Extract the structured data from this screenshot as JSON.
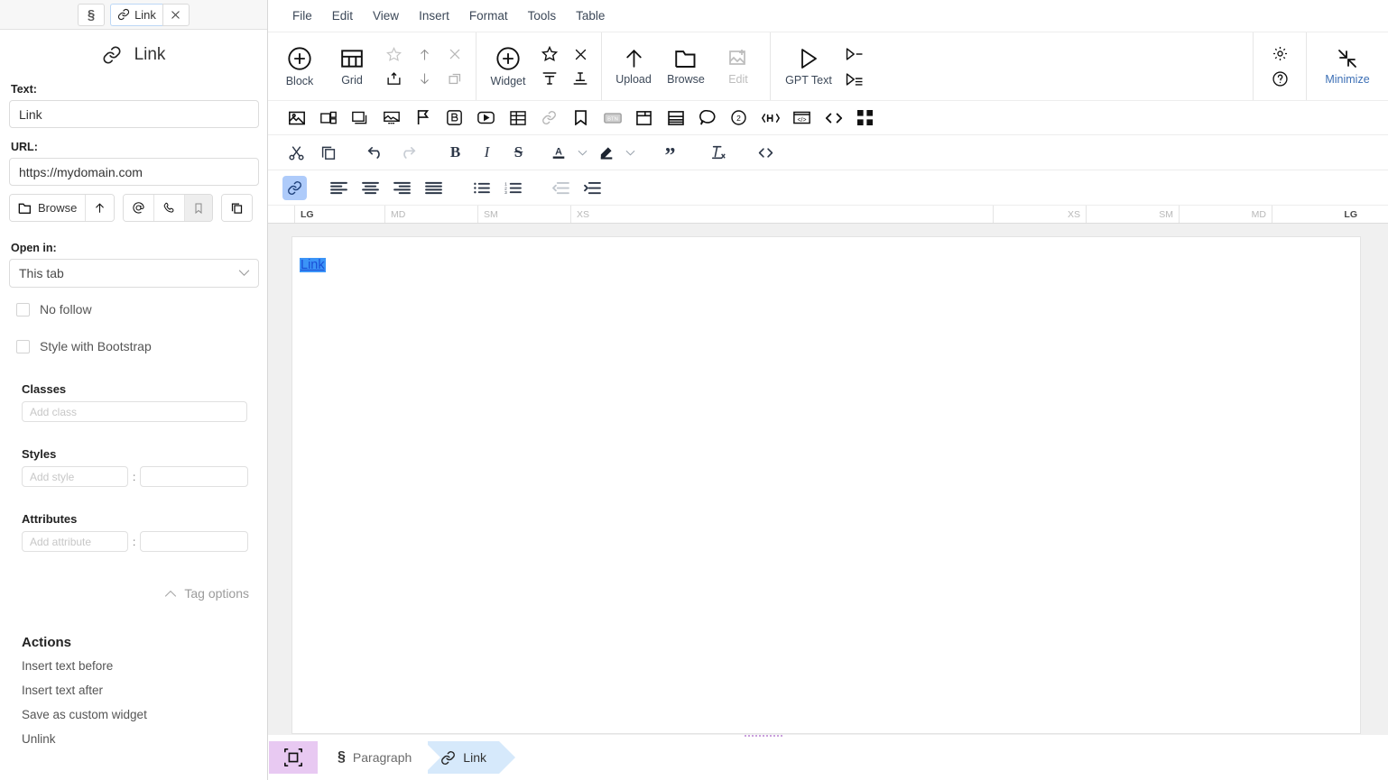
{
  "sidebar": {
    "tabs": [
      {
        "name": "paragraph-tab",
        "icon": "paragraph-icon",
        "label": ""
      },
      {
        "name": "link-tab",
        "icon": "link-icon",
        "label": "Link"
      },
      {
        "name": "close-tab",
        "icon": "close-icon",
        "label": ""
      }
    ],
    "panel_title": "Link",
    "panel_icon": "link-icon",
    "text_field": {
      "label": "Text:",
      "value": "Link"
    },
    "url_field": {
      "label": "URL:",
      "value": "https://mydomain.com"
    },
    "url_buttons": [
      {
        "name": "browse-button",
        "label": "Browse",
        "icon": "folder-icon"
      },
      {
        "name": "upload-button",
        "label": "",
        "icon": "arrow-up-icon"
      },
      {
        "name": "email-button",
        "label": "",
        "icon": "at-icon"
      },
      {
        "name": "phone-button",
        "label": "",
        "icon": "phone-icon"
      },
      {
        "name": "anchor-button",
        "label": "",
        "icon": "bookmark-icon"
      },
      {
        "name": "copy-button",
        "label": "",
        "icon": "copy-icon"
      }
    ],
    "open_in": {
      "label": "Open in:",
      "value": "This tab"
    },
    "checkboxes": [
      {
        "name": "no-follow-checkbox",
        "label": "No follow",
        "checked": false
      },
      {
        "name": "style-bootstrap-checkbox",
        "label": "Style with Bootstrap",
        "checked": false
      }
    ],
    "classes": {
      "label": "Classes",
      "placeholder": "Add class",
      "value": ""
    },
    "styles": {
      "label": "Styles",
      "placeholder": "Add style",
      "value": "",
      "value_placeholder": ""
    },
    "attributes": {
      "label": "Attributes",
      "placeholder": "Add attribute",
      "value": "",
      "value_placeholder": ""
    },
    "tag_options": "Tag options",
    "actions_heading": "Actions",
    "actions": [
      "Insert text before",
      "Insert text after",
      "Save as custom widget",
      "Unlink"
    ]
  },
  "menubar": [
    "File",
    "Edit",
    "View",
    "Insert",
    "Format",
    "Tools",
    "Table"
  ],
  "bigbar": {
    "block": {
      "label": "Block",
      "icon": "plus-circle-icon"
    },
    "grid": {
      "label": "Grid",
      "icon": "grid-icon"
    },
    "block_mini": [
      {
        "name": "favorite-block-icon",
        "disabled": true
      },
      {
        "name": "move-up-icon",
        "disabled": false
      },
      {
        "name": "delete-block-icon",
        "disabled": true
      },
      {
        "name": "save-block-icon",
        "disabled": false
      },
      {
        "name": "move-down-icon",
        "disabled": false
      },
      {
        "name": "duplicate-block-icon",
        "disabled": true
      }
    ],
    "widget": {
      "label": "Widget",
      "icon": "plus-circle-icon"
    },
    "widget_mini": [
      {
        "name": "favorite-widget-icon"
      },
      {
        "name": "remove-widget-icon"
      },
      {
        "name": "align-text-top-icon"
      },
      {
        "name": "align-text-bottom-icon"
      }
    ],
    "upload": {
      "label": "Upload",
      "icon": "arrow-up-icon"
    },
    "browse": {
      "label": "Browse",
      "icon": "folder-icon"
    },
    "edit": {
      "label": "Edit",
      "icon": "image-edit-icon",
      "disabled": true
    },
    "gpt_text": {
      "label": "GPT Text",
      "icon": "play-icon"
    },
    "gpt_mini": [
      {
        "name": "gpt-short-icon"
      },
      {
        "name": "gpt-long-icon"
      }
    ],
    "settings": {
      "name": "gear-icon"
    },
    "help": {
      "name": "help-circle-icon"
    },
    "minimize": {
      "label": "Minimize",
      "icon": "minimize-icon"
    }
  },
  "insertbar": [
    "image-icon",
    "image-gallery-icon",
    "image-stack-icon",
    "image-slider-icon",
    "flag-icon",
    "bootstrap-icon",
    "video-icon",
    "table-icon",
    "link-icon",
    "bookmark-icon",
    "button-icon",
    "card-icon",
    "layout-icon",
    "comment-icon",
    "circle-two-icon",
    "heading-icon",
    "iframe-icon",
    "code-icon",
    "qr-icon"
  ],
  "formatbar": [
    "cut-icon",
    "copy-icon",
    "undo-icon",
    "redo-icon",
    "bold-icon",
    "italic-icon",
    "strikethrough-icon",
    "font-color-icon",
    "chevron-down-icon",
    "highlight-color-icon",
    "chevron-down-icon",
    "blockquote-icon",
    "clear-formatting-icon",
    "source-code-icon"
  ],
  "alignbar": [
    "link-icon",
    "align-left-icon",
    "align-center-icon",
    "align-right-icon",
    "align-justify-icon",
    "bullet-list-icon",
    "numbered-list-icon",
    "outdent-icon",
    "indent-icon"
  ],
  "ruler": {
    "left": [
      "LG",
      "MD",
      "SM",
      "XS"
    ],
    "right": [
      "XS",
      "SM",
      "MD",
      "LG"
    ]
  },
  "canvas": {
    "link_text": "Link"
  },
  "statusbar": {
    "select_tool": "select-element-icon",
    "breadcrumbs": [
      {
        "label": "Paragraph",
        "icon": "paragraph-icon",
        "active": false
      },
      {
        "label": "Link",
        "icon": "link-icon",
        "active": true
      }
    ]
  },
  "colors": {
    "accent_blue": "#aecbfa",
    "selection_blue": "#3b94f7",
    "crumb_active": "#d6e9fb",
    "tool_purple": "#e8c9f2",
    "canvas_bg": "#f0f0f0",
    "text": "#3c4858"
  }
}
